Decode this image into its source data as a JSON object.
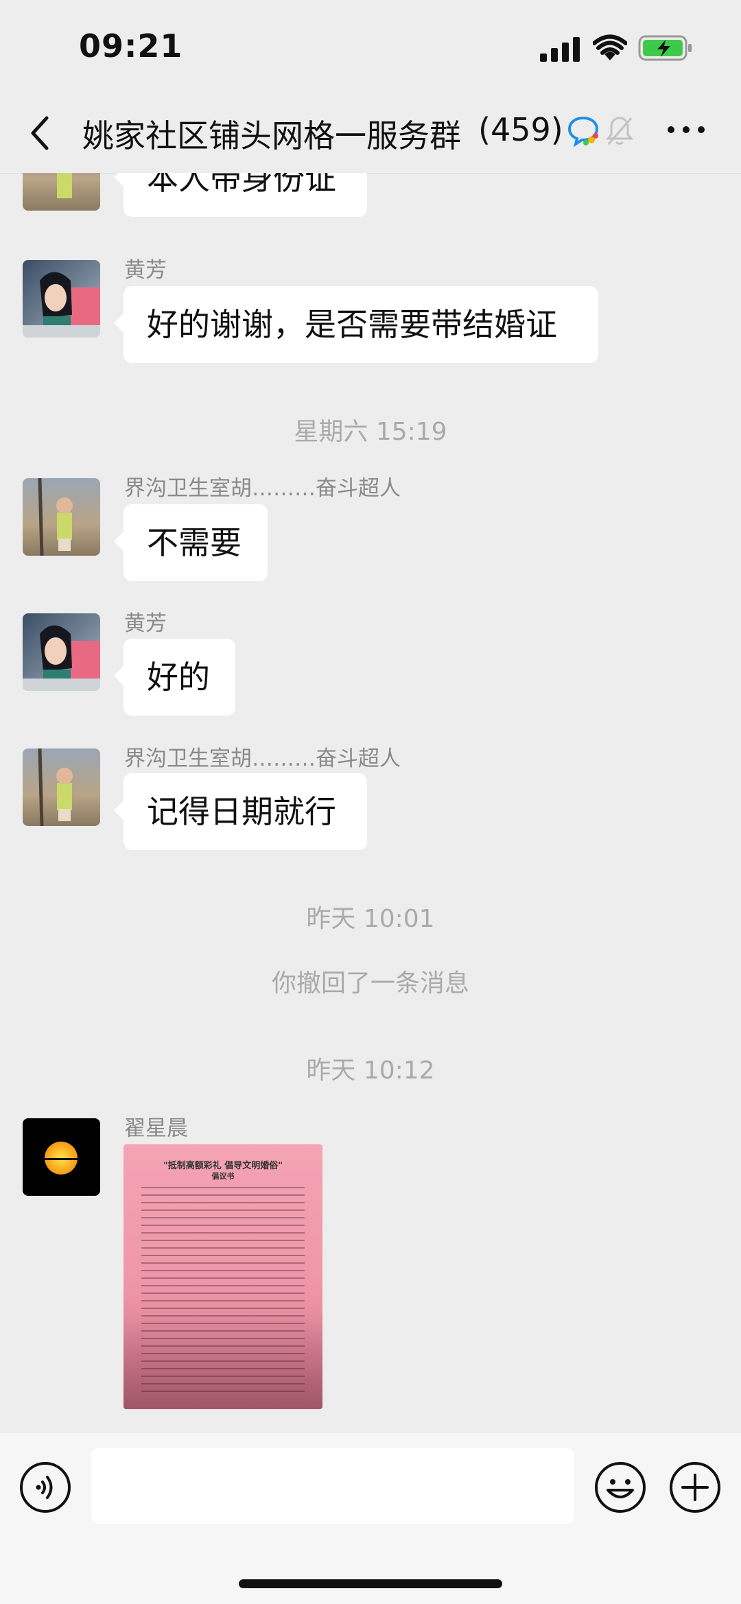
{
  "status": {
    "time": "09:21"
  },
  "header": {
    "title": "姚家社区铺头网格一服务群",
    "count": "(459)"
  },
  "messages": {
    "m0": {
      "text": "本人带身份证"
    },
    "m1": {
      "sender": "黄芳",
      "text": "好的谢谢，是否需要带结婚证"
    },
    "ts1": "星期六 15:19",
    "m2": {
      "sender": "界沟卫生室胡………奋斗超人",
      "text": "不需要"
    },
    "m3": {
      "sender": "黄芳",
      "text": "好的"
    },
    "m4": {
      "sender": "界沟卫生室胡………奋斗超人",
      "text": "记得日期就行"
    },
    "ts2": "昨天 10:01",
    "recall": "你撤回了一条消息",
    "ts3": "昨天 10:12",
    "m5": {
      "sender": "翟星晨",
      "image_title": "\"抵制高额彩礼 倡导文明婚俗\"",
      "image_subtitle": "倡议书"
    }
  },
  "input": {
    "placeholder": ""
  },
  "icons": {
    "back": "chevron-left-icon",
    "group_chat": "chat-bubble-icon",
    "muted": "bell-slash-icon",
    "more": "more-dots-icon",
    "voice": "voice-icon",
    "emoji": "emoji-icon",
    "plus": "plus-icon"
  },
  "colors": {
    "background": "#ededed",
    "bubble": "#ffffff",
    "meta_text": "#aaaaaa"
  }
}
